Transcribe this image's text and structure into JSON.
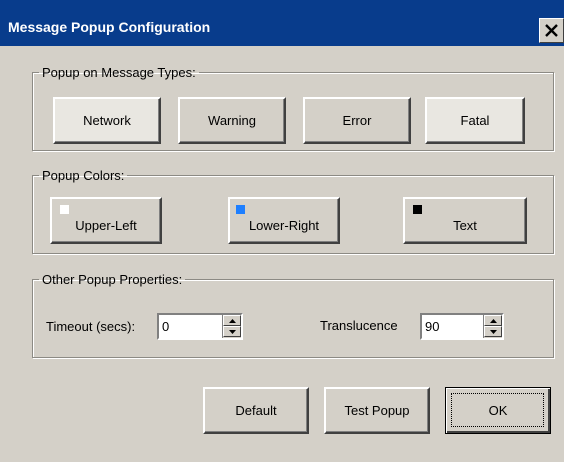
{
  "window": {
    "title": "Message Popup Configuration"
  },
  "groups": {
    "types": {
      "legend": "Popup on Message Types:",
      "buttons": {
        "network": "Network",
        "warning": "Warning",
        "error": "Error",
        "fatal": "Fatal"
      }
    },
    "colors": {
      "legend": "Popup Colors:",
      "buttons": {
        "upper_left": "Upper-Left",
        "lower_right": "Lower-Right",
        "text": "Text"
      },
      "swatches": {
        "upper_left": "#ffffff",
        "lower_right": "#1e7fff",
        "text": "#000000"
      }
    },
    "other": {
      "legend": "Other Popup Properties:",
      "timeout_label": "Timeout (secs):",
      "timeout_value": "0",
      "translucence_label": "Translucence",
      "translucence_value": "90"
    }
  },
  "footer": {
    "default": "Default",
    "test": "Test Popup",
    "ok": "OK"
  }
}
